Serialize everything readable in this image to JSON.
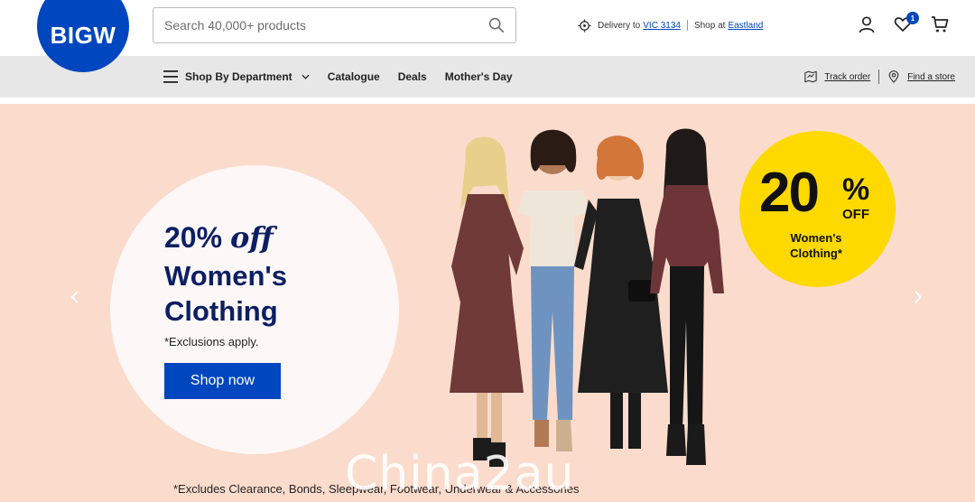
{
  "header": {
    "logo_text": "BIGW",
    "search_placeholder": "Search 40,000+ products",
    "delivery_label": "Delivery to",
    "delivery_location": "VIC 3134",
    "shop_label": "Shop at",
    "shop_store": "Eastland",
    "wishlist_count": "1",
    "icons": [
      "search-icon",
      "location-target-icon",
      "account-icon",
      "wishlist-heart-icon",
      "cart-icon"
    ]
  },
  "nav": {
    "department": "Shop By Department",
    "catalogue": "Catalogue",
    "deals": "Deals",
    "mothers_day": "Mother's Day",
    "track_order": "Track order",
    "find_store": "Find a store"
  },
  "hero": {
    "pct": "20%",
    "off": "off",
    "title": "Women's Clothing",
    "note": "*Exclusions apply.",
    "cta": "Shop now",
    "badge_number": "20",
    "badge_pct": "%",
    "badge_off": "OFF",
    "badge_sub": "Women's Clothing*",
    "disclaimer": "*Excludes Clearance, Bonds, Sleepwear, Footwear, Underwear & Accessories",
    "watermark": "Chinа2au"
  },
  "colors": {
    "brand_blue": "#0046be",
    "navy_text": "#0c1f63",
    "hero_bg": "#fbdccc",
    "badge_yellow": "#fdd900",
    "nav_bg": "#e7e7e7"
  }
}
